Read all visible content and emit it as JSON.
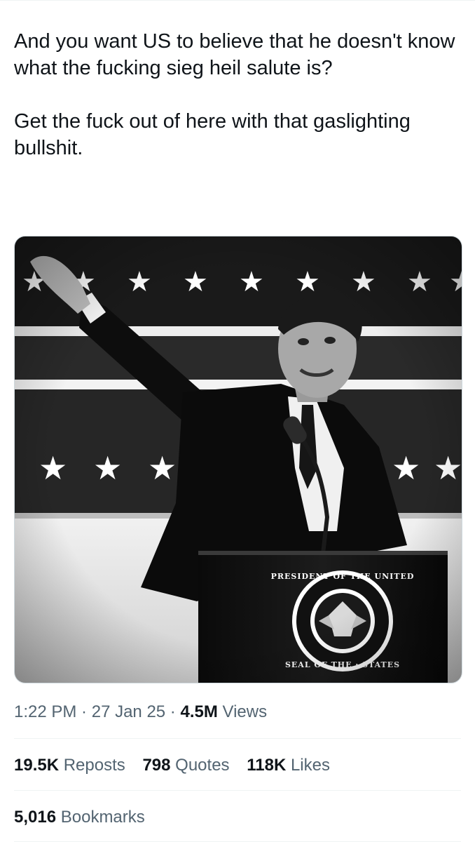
{
  "tweet": {
    "text_paragraph_1": "And you want US to believe that he doesn't know what the fucking sieg heil salute is?",
    "text_paragraph_2": "Get the fuck out of here with that gaslighting bullshit.",
    "image": {
      "style": "black-and-white",
      "seal_text": "SEAL OF THE PRESIDENT OF THE UNITED STATES"
    },
    "meta": {
      "time": "1:22 PM",
      "separator": " · ",
      "date": "27 Jan 25",
      "views_count": "4.5M",
      "views_label": "Views"
    },
    "stats": {
      "reposts_count": "19.5K",
      "reposts_label": "Reposts",
      "quotes_count": "798",
      "quotes_label": "Quotes",
      "likes_count": "118K",
      "likes_label": "Likes"
    },
    "bookmarks": {
      "count": "5,016",
      "label": "Bookmarks"
    }
  },
  "colors": {
    "text_primary": "#0f1419",
    "text_secondary": "#536471",
    "divider": "#eff3f4",
    "media_border": "#cfd9de"
  }
}
